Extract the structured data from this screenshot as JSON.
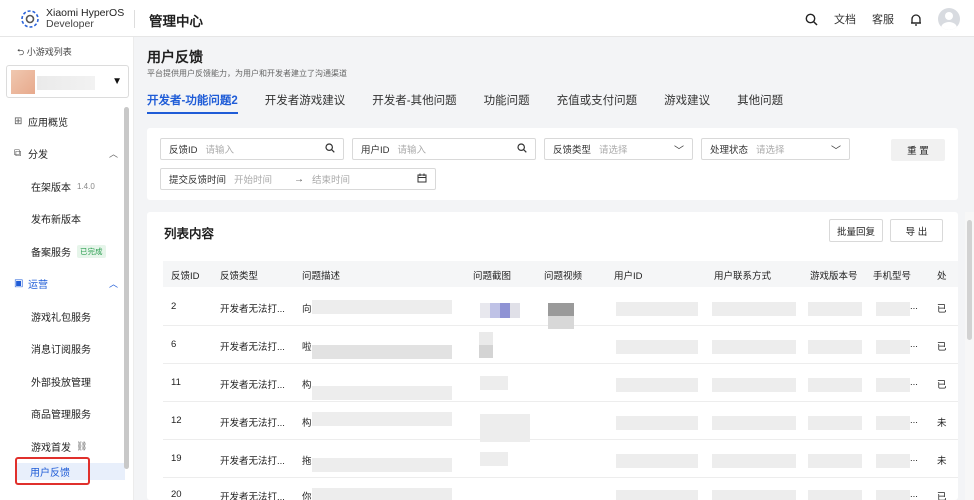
{
  "brand": {
    "name_line1": "Xiaomi HyperOS",
    "name_line2": "Developer"
  },
  "app_title": "管理中心",
  "topbar": {
    "docs": "文档",
    "support": "客服"
  },
  "sidebar": {
    "back_label": "小游戏列表",
    "items": [
      {
        "label": "应用概览",
        "type": "top"
      },
      {
        "label": "分发",
        "type": "top",
        "expanded": true
      },
      {
        "label": "在架版本",
        "type": "sub",
        "version": "1.4.0"
      },
      {
        "label": "发布新版本",
        "type": "sub"
      },
      {
        "label": "备案服务",
        "type": "sub",
        "badge": "已完成"
      },
      {
        "label": "运营",
        "type": "top",
        "expanded": true
      },
      {
        "label": "游戏礼包服务",
        "type": "sub"
      },
      {
        "label": "消息订阅服务",
        "type": "sub"
      },
      {
        "label": "外部投放管理",
        "type": "sub"
      },
      {
        "label": "商品管理服务",
        "type": "sub"
      },
      {
        "label": "游戏首发",
        "type": "sub"
      },
      {
        "label": "用户反馈",
        "type": "sub",
        "active": true
      }
    ]
  },
  "page": {
    "title": "用户反馈",
    "subtitle": "平台提供用户反馈能力，为用户和开发者建立了沟通渠道"
  },
  "tabs": [
    {
      "label": "开发者-功能问题2",
      "active": true
    },
    {
      "label": "开发者游戏建议"
    },
    {
      "label": "开发者-其他问题"
    },
    {
      "label": "功能问题"
    },
    {
      "label": "充值或支付问题"
    },
    {
      "label": "游戏建议"
    },
    {
      "label": "其他问题"
    }
  ],
  "filters": {
    "feedback_id": {
      "label": "反馈ID",
      "placeholder": "请输入"
    },
    "user_id": {
      "label": "用户ID",
      "placeholder": "请输入"
    },
    "feedback_type": {
      "label": "反馈类型",
      "placeholder": "请选择"
    },
    "status": {
      "label": "处理状态",
      "placeholder": "请选择"
    },
    "reset": "重 置",
    "submit_time": {
      "label": "提交反馈时间",
      "start": "开始时间",
      "end": "结束时间"
    }
  },
  "list": {
    "title": "列表内容",
    "batch_reply": "批量回复",
    "export": "导 出",
    "columns": [
      "反馈ID",
      "反馈类型",
      "问题描述",
      "问题截图",
      "问题视频",
      "用户ID",
      "用户联系方式",
      "游戏版本号",
      "手机型号",
      "处"
    ],
    "rows": [
      {
        "id": "2",
        "type": "开发者无法打...",
        "desc_start": "向",
        "model_suffix": "...",
        "status_start": "已"
      },
      {
        "id": "6",
        "type": "开发者无法打...",
        "desc_start": "啦",
        "model_suffix": "...",
        "status_start": "已"
      },
      {
        "id": "11",
        "type": "开发者无法打...",
        "desc_start": "构",
        "model_suffix": "...",
        "status_start": "已"
      },
      {
        "id": "12",
        "type": "开发者无法打...",
        "desc_start": "构",
        "model_suffix": "...",
        "status_start": "未"
      },
      {
        "id": "19",
        "type": "开发者无法打...",
        "desc_start": "拖",
        "model_suffix": "...",
        "status_start": "未"
      },
      {
        "id": "20",
        "type": "开发者无法打...",
        "desc_start": "你",
        "model_suffix": "...",
        "status_start": "已"
      }
    ]
  },
  "colors": {
    "accent": "#1f5cd7",
    "highlight": "#e0302c",
    "success": "#2a9d4f"
  }
}
